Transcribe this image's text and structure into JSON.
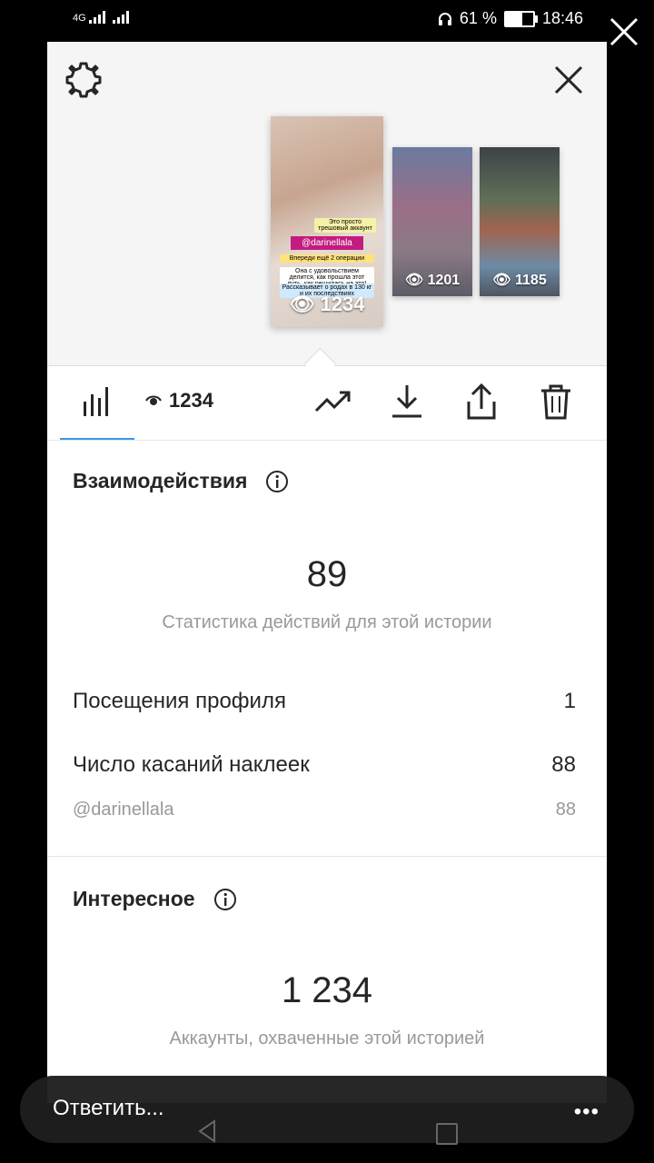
{
  "status_bar": {
    "signal1": "4G",
    "battery": "61 %",
    "time": "18:46",
    "battery_level": 0.61
  },
  "preview": {
    "main_story": {
      "views": "1234",
      "mention": "@darinellala",
      "stickers": [
        "Это просто трешовый аккаунт",
        "Впереди ещё 2 операции",
        "Она с удовольствием делится, как прошла этот путь, как решилась на это!",
        "Рассказывает о родах в 130 кг и их последствиях"
      ]
    },
    "stories": [
      {
        "views": "1201"
      },
      {
        "views": "1185"
      }
    ]
  },
  "toolbar": {
    "views": "1234"
  },
  "interactions": {
    "title": "Взаимодействия",
    "total": "89",
    "caption": "Статистика действий для этой истории",
    "rows": [
      {
        "label": "Посещения профиля",
        "value": "1"
      },
      {
        "label": "Число касаний наклеек",
        "value": "88"
      }
    ],
    "sub_row": {
      "label": "@darinellala",
      "value": "88"
    }
  },
  "discovery": {
    "title": "Интересное",
    "total": "1 234",
    "caption": "Аккаунты, охваченные этой историей"
  },
  "reply_bar": {
    "placeholder": "Ответить...",
    "more": "•••"
  },
  "colors": {
    "accent": "#3897f0",
    "text": "#262626",
    "muted": "#999999"
  }
}
